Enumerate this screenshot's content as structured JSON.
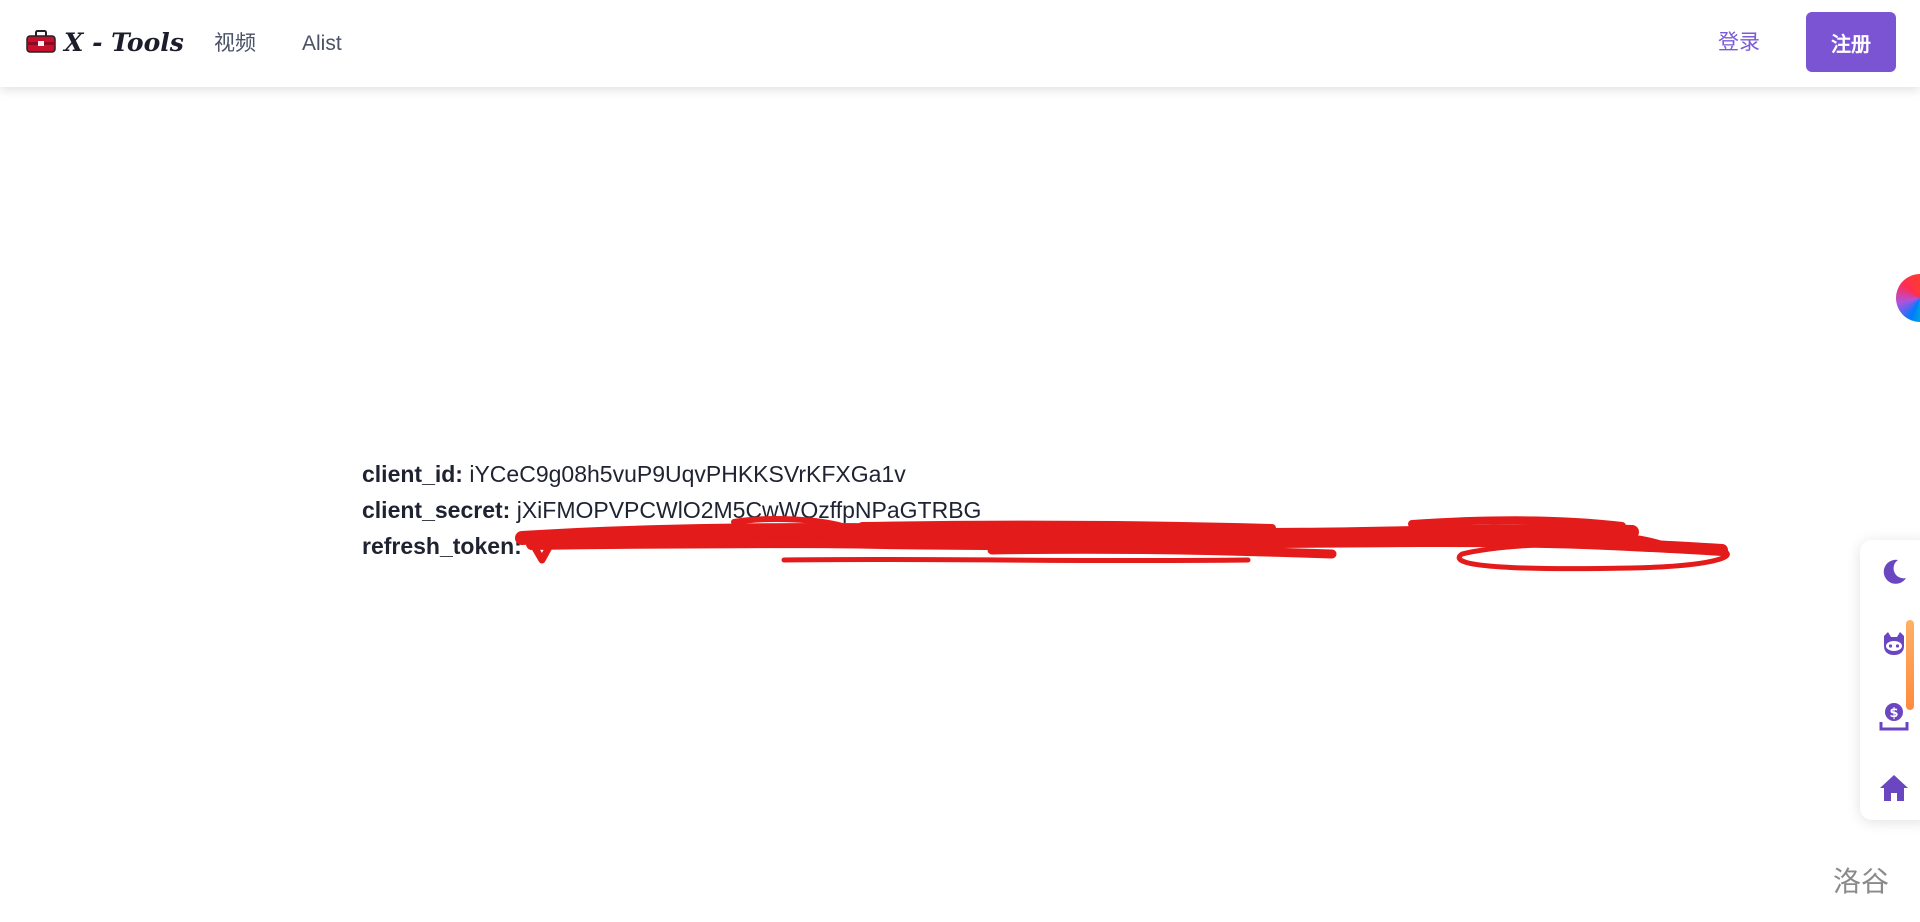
{
  "header": {
    "logo_text": "X - Tools",
    "nav": [
      {
        "label": "视频"
      },
      {
        "label": "Alist"
      }
    ],
    "login_label": "登录",
    "register_label": "注册"
  },
  "credentials": [
    {
      "key": "client_id:",
      "value": "iYCeC9g08h5vuP9UqvPHKKSVrKFXGa1v"
    },
    {
      "key": "client_secret:",
      "value": "jXiFMOPVPCWlO2M5CwWQzffpNPaGTRBG"
    },
    {
      "key": "refresh_token:",
      "value": ""
    }
  ],
  "side_buttons": [
    {
      "icon": "moon-icon"
    },
    {
      "icon": "github-icon"
    },
    {
      "icon": "donate-icon"
    },
    {
      "icon": "home-icon"
    }
  ],
  "colors": {
    "accent": "#7b54d4",
    "redaction": "#e31b1b"
  },
  "watermark": "洛谷"
}
